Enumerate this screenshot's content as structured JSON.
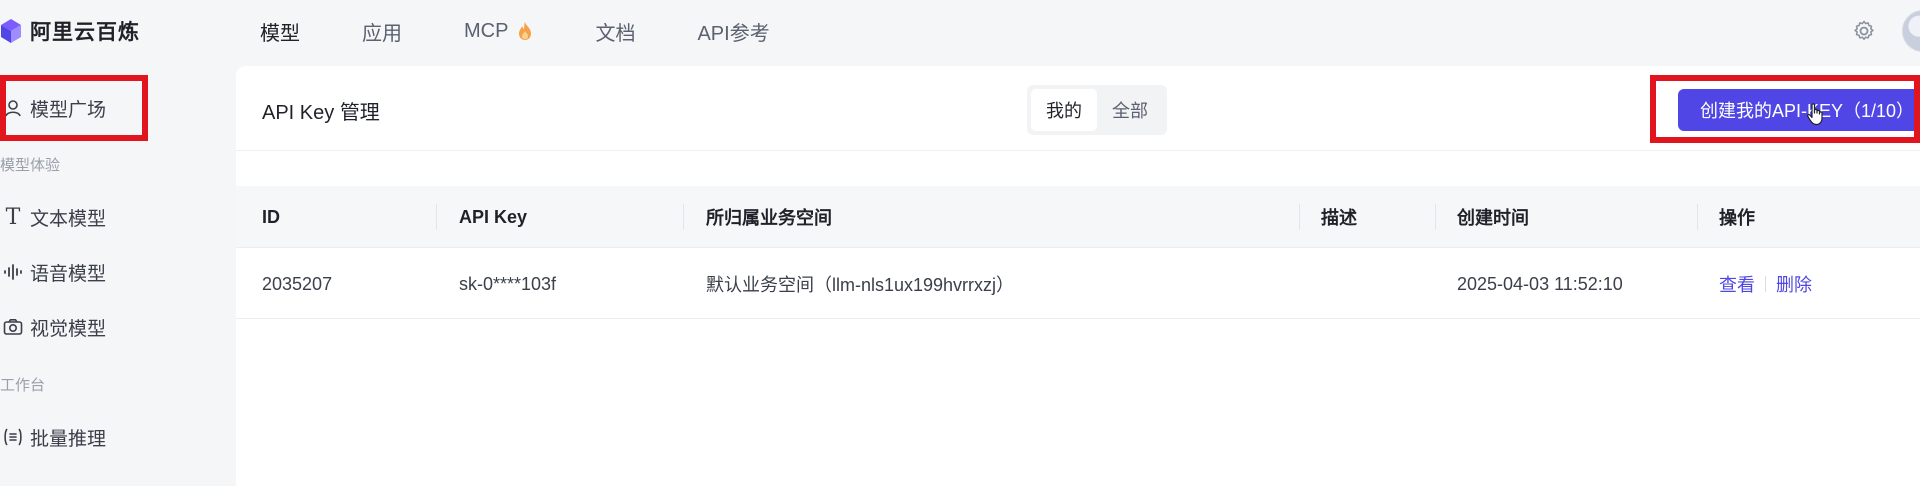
{
  "app": {
    "name": "阿里云百炼"
  },
  "nav": [
    {
      "label": "模型",
      "active": true
    },
    {
      "label": "应用"
    },
    {
      "label": "MCP",
      "icon": "flame-icon"
    },
    {
      "label": "文档"
    },
    {
      "label": "API参考"
    }
  ],
  "sidebar": {
    "top_item": {
      "label": "模型广场",
      "icon": "model-square-icon"
    },
    "groups": [
      {
        "title": "模型体验",
        "items": [
          {
            "label": "文本模型",
            "icon": "text-icon"
          },
          {
            "label": "语音模型",
            "icon": "waveform-icon"
          },
          {
            "label": "视觉模型",
            "icon": "camera-icon"
          }
        ]
      },
      {
        "title": "工作台",
        "items": [
          {
            "label": "批量推理",
            "icon": "list-icon"
          }
        ]
      }
    ]
  },
  "panel": {
    "title": "API Key 管理",
    "segments": [
      {
        "label": "我的",
        "active": true
      },
      {
        "label": "全部"
      }
    ],
    "create_button": "创建我的API-KEY（1/10）"
  },
  "table": {
    "columns": [
      "ID",
      "API Key",
      "所归属业务空间",
      "描述",
      "创建时间",
      "操作"
    ],
    "rows": [
      {
        "id": "2035207",
        "api_key": "sk-0****103f",
        "workspace": "默认业务空间（llm-nls1ux199hvrrxzj）",
        "description": "",
        "created": "2025-04-03 11:52:10",
        "actions": [
          "查看",
          "删除"
        ]
      }
    ]
  },
  "colors": {
    "accent": "#4f46e5",
    "highlight": "#e0151d"
  }
}
